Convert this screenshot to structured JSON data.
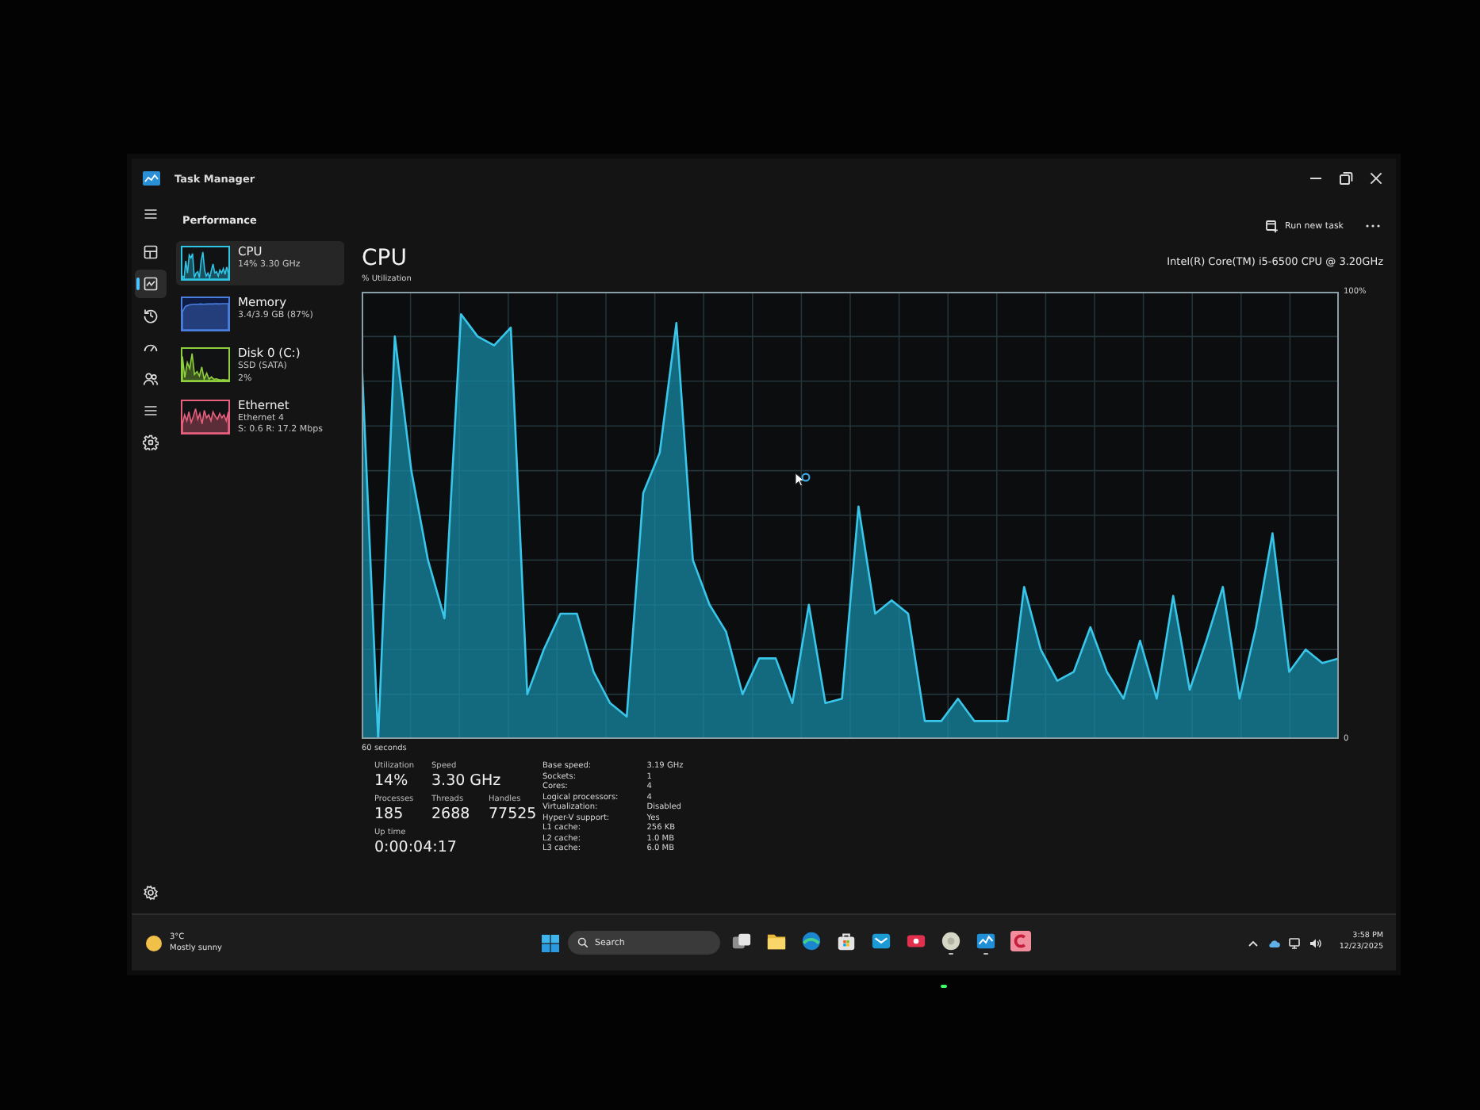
{
  "window": {
    "title": "Task Manager"
  },
  "header": {
    "title": "Performance",
    "run_new_task": "Run new task"
  },
  "nav": [
    {
      "kind": "processes",
      "selected": false
    },
    {
      "kind": "performance",
      "selected": true
    },
    {
      "kind": "history",
      "selected": false
    },
    {
      "kind": "startup",
      "selected": false
    },
    {
      "kind": "users",
      "selected": false
    },
    {
      "kind": "details",
      "selected": false
    },
    {
      "kind": "services",
      "selected": false
    }
  ],
  "resources": [
    {
      "kind": "cpu",
      "name": "CPU",
      "details": [
        "14% 3.30 GHz"
      ],
      "color": "#2ec4e6",
      "selected": true
    },
    {
      "kind": "memory",
      "name": "Memory",
      "details": [
        "3.4/3.9 GB (87%)"
      ],
      "color": "#4a7fe0",
      "selected": false
    },
    {
      "kind": "disk",
      "name": "Disk 0 (C:)",
      "details": [
        "SSD (SATA)",
        "2%"
      ],
      "color": "#8fd03c",
      "selected": false
    },
    {
      "kind": "network",
      "name": "Ethernet",
      "details": [
        "Ethernet 4",
        "S: 0.6 R: 17.2 Mbps"
      ],
      "color": "#e8607e",
      "selected": false
    }
  ],
  "panel": {
    "title": "CPU",
    "processor": "Intel(R) Core(TM) i5-6500 CPU @ 3.20GHz",
    "chart_data": {
      "type": "area",
      "xlabel": "60 seconds",
      "ylabel": "% Utilization",
      "ylim": [
        0,
        100
      ],
      "yticks": [
        {
          "value": 0,
          "label": "0"
        },
        {
          "value": 100,
          "label": "100%"
        }
      ],
      "grid": true,
      "values": [
        85,
        0,
        90,
        60,
        40,
        27,
        95,
        90,
        88,
        92,
        10,
        20,
        28,
        28,
        15,
        8,
        5,
        55,
        64,
        93,
        40,
        30,
        24,
        10,
        18,
        18,
        8,
        30,
        8,
        9,
        52,
        28,
        31,
        28,
        4,
        4,
        9,
        4,
        4,
        4,
        34,
        20,
        13,
        15,
        25,
        15,
        9,
        22,
        9,
        32,
        11,
        22,
        34,
        9,
        25,
        46,
        15,
        20,
        17,
        18
      ]
    },
    "stats": [
      [
        {
          "label": "Utilization",
          "value": "14%"
        },
        {
          "label": "Speed",
          "value": "3.30 GHz"
        }
      ],
      [
        {
          "label": "Processes",
          "value": "185"
        },
        {
          "label": "Threads",
          "value": "2688"
        },
        {
          "label": "Handles",
          "value": "77525"
        }
      ],
      [
        {
          "label": "Up time",
          "value": "0:00:04:17"
        }
      ]
    ],
    "specs": [
      {
        "label": "Base speed:",
        "value": "3.19 GHz"
      },
      {
        "label": "Sockets:",
        "value": "1"
      },
      {
        "label": "Cores:",
        "value": "4"
      },
      {
        "label": "Logical processors:",
        "value": "4"
      },
      {
        "label": "Virtualization:",
        "value": "Disabled"
      },
      {
        "label": "Hyper-V support:",
        "value": "Yes"
      },
      {
        "label": "L1 cache:",
        "value": "256 KB"
      },
      {
        "label": "L2 cache:",
        "value": "1.0 MB"
      },
      {
        "label": "L3 cache:",
        "value": "6.0 MB"
      }
    ]
  },
  "taskbar": {
    "weather": {
      "temperature": "3°C",
      "condition": "Mostly sunny"
    },
    "search": {
      "placeholder": "Search"
    },
    "apps": [
      {
        "kind": "task-view",
        "running": false
      },
      {
        "kind": "explorer",
        "running": false
      },
      {
        "kind": "browser",
        "running": false
      },
      {
        "kind": "store",
        "running": false
      },
      {
        "kind": "mail",
        "running": false
      },
      {
        "kind": "media",
        "running": false
      },
      {
        "kind": "round",
        "running": true
      },
      {
        "kind": "task-manager",
        "running": true
      },
      {
        "kind": "c-app",
        "running": false
      }
    ],
    "clock": {
      "time": "3:58 PM",
      "date": "12/23/2025"
    }
  }
}
